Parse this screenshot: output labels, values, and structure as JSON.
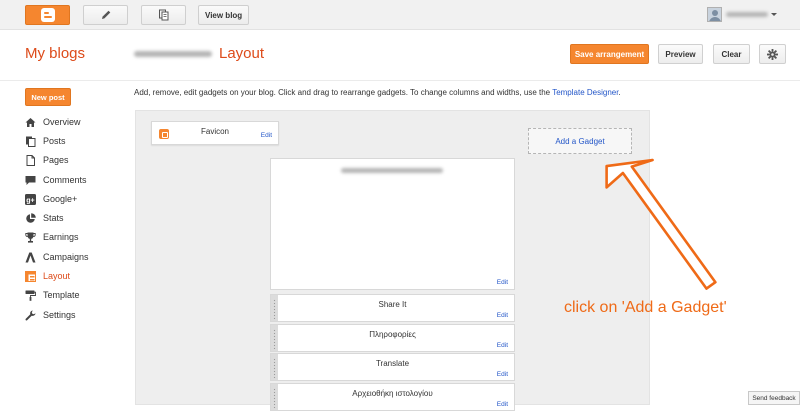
{
  "topbar": {
    "view_blog": "View blog"
  },
  "header": {
    "my_blogs": "My blogs",
    "page_title": "Layout",
    "save_arrangement": "Save arrangement",
    "preview": "Preview",
    "clear": "Clear"
  },
  "sidebar": {
    "new_post": "New post",
    "items": [
      {
        "label": "Overview",
        "icon": "home-icon"
      },
      {
        "label": "Posts",
        "icon": "posts-icon"
      },
      {
        "label": "Pages",
        "icon": "pages-icon"
      },
      {
        "label": "Comments",
        "icon": "comment-icon"
      },
      {
        "label": "Google+",
        "icon": "google-plus-icon"
      },
      {
        "label": "Stats",
        "icon": "pie-chart-icon"
      },
      {
        "label": "Earnings",
        "icon": "trophy-icon"
      },
      {
        "label": "Campaigns",
        "icon": "campaigns-icon"
      },
      {
        "label": "Layout",
        "icon": "layout-icon"
      },
      {
        "label": "Template",
        "icon": "paint-roller-icon"
      },
      {
        "label": "Settings",
        "icon": "wrench-icon"
      }
    ]
  },
  "main": {
    "intro_text": "Add, remove, edit gadgets on your blog. Click and drag to rearrange gadgets. To change columns and widths, use the ",
    "intro_link": "Template Designer",
    "intro_end": ".",
    "add_gadget": "Add a Gadget",
    "edit_label": "Edit",
    "favicon_title": "Favicon",
    "gadgets": [
      {
        "title": "Share It"
      },
      {
        "title": "Πληροφορίες"
      },
      {
        "title": "Translate"
      },
      {
        "title": "Αρχειοθήκη ιστολογίου"
      }
    ]
  },
  "annotation": {
    "callout": "click on 'Add a Gadget'"
  },
  "footer": {
    "send_feedback": "Send feedback"
  },
  "colors": {
    "accent": "#f5862f",
    "title_orange": "#dd4b1a",
    "link_blue": "#2356c8",
    "callout_orange": "#ef6a17"
  }
}
